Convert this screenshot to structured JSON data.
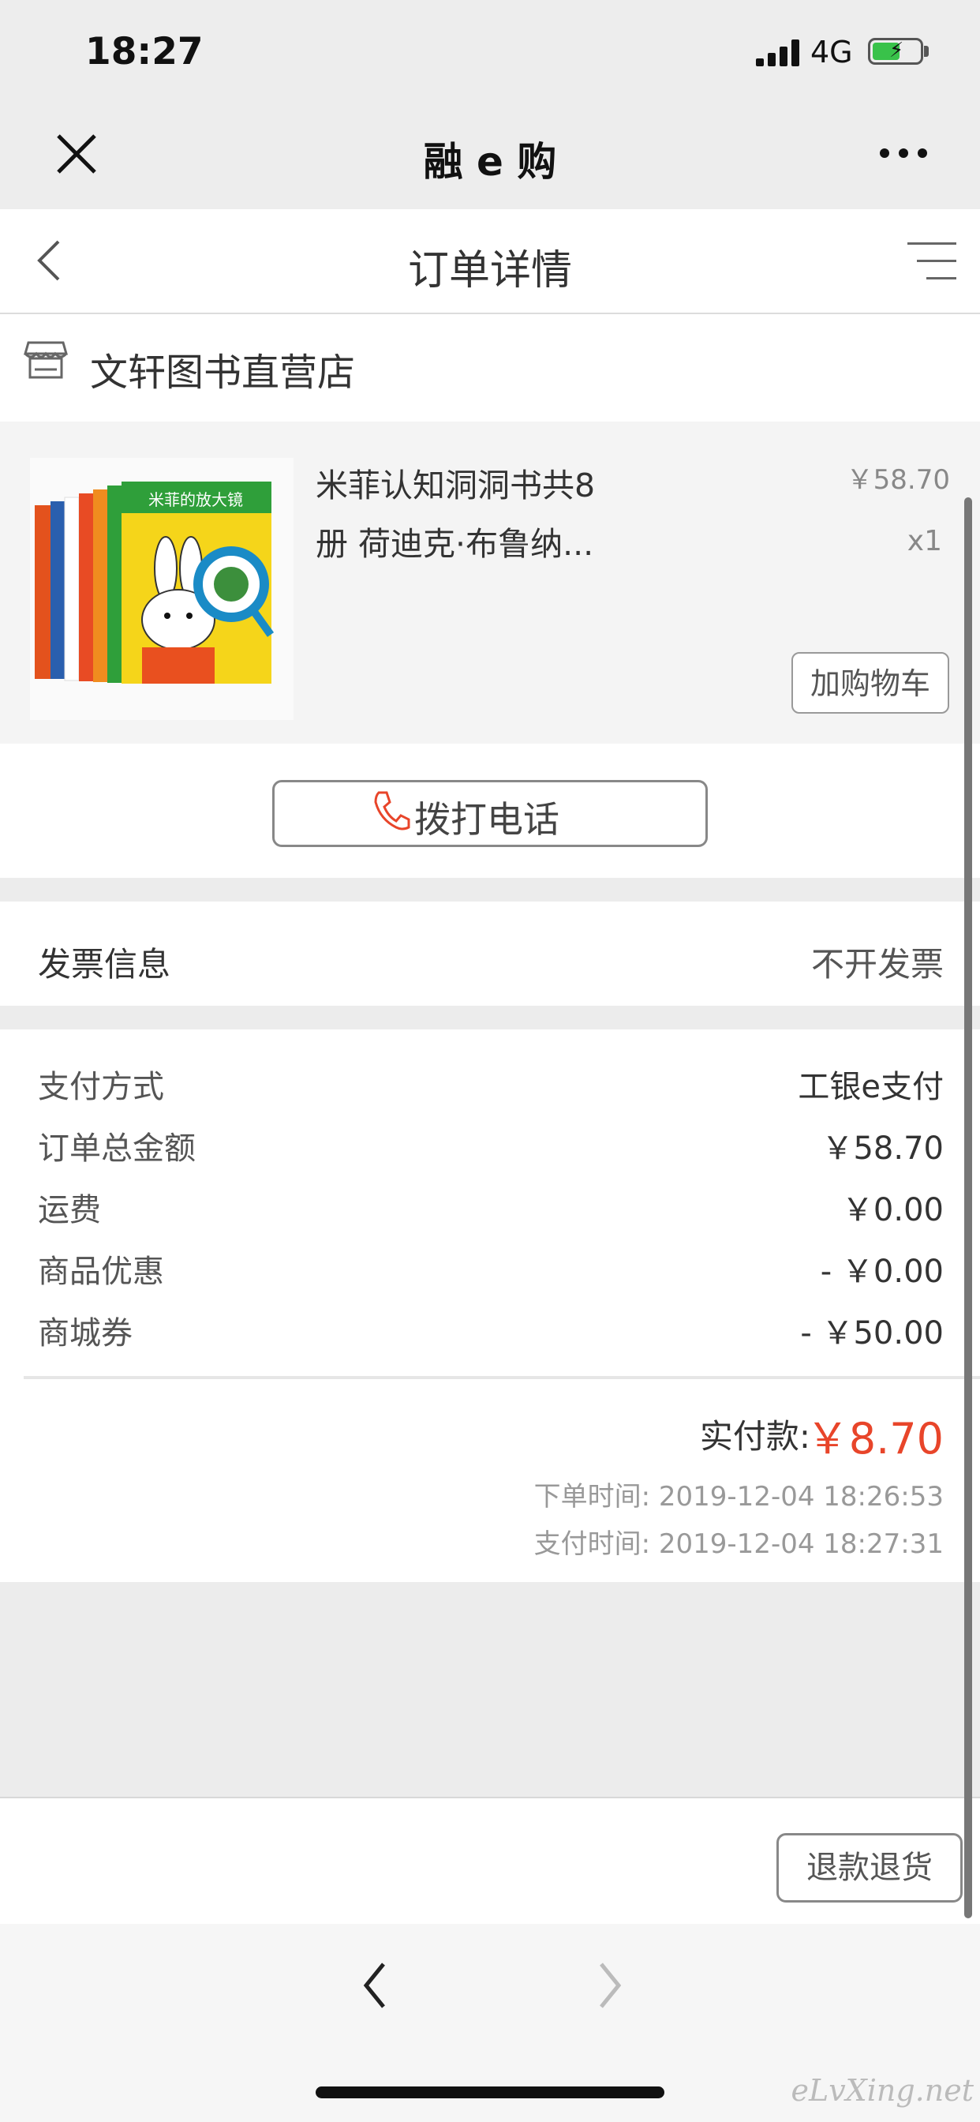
{
  "status_bar": {
    "time": "18:27",
    "network": "4G"
  },
  "mini_program": {
    "title": "融 e 购"
  },
  "page": {
    "title": "订单详情"
  },
  "store": {
    "name": "文轩图书直营店"
  },
  "product": {
    "name": "米菲认知洞洞书共8册 荷迪克·布鲁纳...",
    "price": "￥58.70",
    "quantity": "x1",
    "add_to_cart_label": "加购物车",
    "cover_title": "米菲的放大镜"
  },
  "call": {
    "label": "拨打电话"
  },
  "invoice": {
    "label": "发票信息",
    "value": "不开发票"
  },
  "payment": {
    "rows": [
      {
        "label": "支付方式",
        "value": "工银e支付"
      },
      {
        "label": "订单总金额",
        "value": "￥58.70"
      },
      {
        "label": "运费",
        "value": "￥0.00"
      },
      {
        "label": "商品优惠",
        "value": "- ￥0.00"
      },
      {
        "label": "商城券",
        "value": "- ￥50.00"
      }
    ],
    "total_label": "实付款:",
    "total_value": "￥8.70",
    "order_time": "下单时间: 2019-12-04 18:26:53",
    "pay_time": "支付时间: 2019-12-04 18:27:31"
  },
  "bottom": {
    "refund_label": "退款退货"
  },
  "watermark": "eLvXing.net",
  "colors": {
    "accent": "#e8452a",
    "battery": "#39c24a"
  }
}
